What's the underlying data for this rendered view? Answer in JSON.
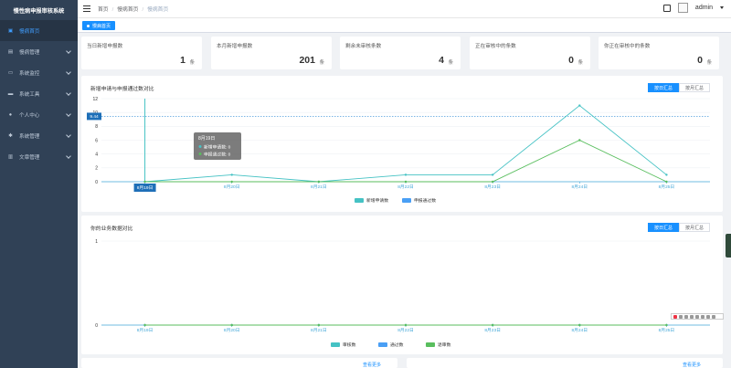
{
  "app": {
    "title": "慢性病申报审核系统"
  },
  "sidebar": {
    "items": [
      {
        "label": "慢病首页",
        "icon": "dashboard-icon",
        "active": true,
        "has_children": false
      },
      {
        "label": "慢病管理",
        "icon": "clipboard-icon",
        "active": false,
        "has_children": true
      },
      {
        "label": "系统监控",
        "icon": "monitor-icon",
        "active": false,
        "has_children": true
      },
      {
        "label": "系统工具",
        "icon": "tool-icon",
        "active": false,
        "has_children": true
      },
      {
        "label": "个人中心",
        "icon": "user-icon",
        "active": false,
        "has_children": true
      },
      {
        "label": "系统管理",
        "icon": "gear-icon",
        "active": false,
        "has_children": true
      },
      {
        "label": "文章管理",
        "icon": "article-icon",
        "active": false,
        "has_children": true
      }
    ]
  },
  "breadcrumb": {
    "items": [
      "首页",
      "慢病首页",
      "慢病首页"
    ]
  },
  "header": {
    "user": "admin"
  },
  "tags": {
    "active": "慢病首页"
  },
  "stats": [
    {
      "label": "当日新增申报数",
      "value": "1",
      "unit": "条"
    },
    {
      "label": "本月新增申报数",
      "value": "201",
      "unit": "条"
    },
    {
      "label": "剩余未审核条数",
      "value": "4",
      "unit": "条"
    },
    {
      "label": "正在审核中的条数",
      "value": "0",
      "unit": "条"
    },
    {
      "label": "你正在审核中的条数",
      "value": "0",
      "unit": "条"
    }
  ],
  "chart1": {
    "title": "新增申请与申报通过数对比",
    "btn_daily": "按日汇总",
    "btn_monthly": "按月汇总",
    "tooltip": {
      "title": "8月19日",
      "row1": "新增申请数: 0",
      "row2": "申报通过数: 0"
    },
    "axis_pointer": {
      "value": "9.44",
      "category": "8月19日"
    }
  },
  "chart2": {
    "title": "你的业务数据对比",
    "btn_daily": "按日汇总",
    "btn_monthly": "按月汇总"
  },
  "bottom": {
    "more1": "查看更多",
    "more2": "查看更多"
  },
  "chart_data": [
    {
      "type": "line",
      "title": "新增申请与申报通过数对比",
      "categories": [
        "8月19日",
        "8月20日",
        "8月21日",
        "8月22日",
        "8月23日",
        "8月24日",
        "8月25日"
      ],
      "series": [
        {
          "name": "新增申请数",
          "color": "#45c2c4",
          "values": [
            0,
            1,
            0,
            1,
            1,
            11,
            1
          ]
        },
        {
          "name": "申报通过数",
          "color": "#59be5e",
          "values": [
            0,
            0,
            0,
            0,
            0,
            6,
            0
          ]
        }
      ],
      "legend_colors": [
        "#45c2c4",
        "#4a9ff5"
      ],
      "ylim": [
        0,
        12
      ],
      "yticks": [
        0,
        2,
        4,
        6,
        8,
        10,
        12
      ],
      "legend_position": "bottom"
    },
    {
      "type": "line",
      "title": "你的业务数据对比",
      "categories": [
        "8月19日",
        "8月20日",
        "8月21日",
        "8月22日",
        "8月23日",
        "8月24日",
        "8月25日"
      ],
      "series": [
        {
          "name": "审核数",
          "color": "#45c2c4",
          "values": [
            0,
            0,
            0,
            0,
            0,
            0,
            0
          ]
        },
        {
          "name": "通过数",
          "color": "#4a9ff5",
          "values": [
            0,
            0,
            0,
            0,
            0,
            0,
            0
          ]
        },
        {
          "name": "退审数",
          "color": "#59be5e",
          "values": [
            0,
            0,
            0,
            0,
            0,
            0,
            0
          ]
        }
      ],
      "ylim": [
        0,
        1
      ],
      "yticks": [
        0,
        1
      ],
      "legend_position": "bottom"
    }
  ]
}
